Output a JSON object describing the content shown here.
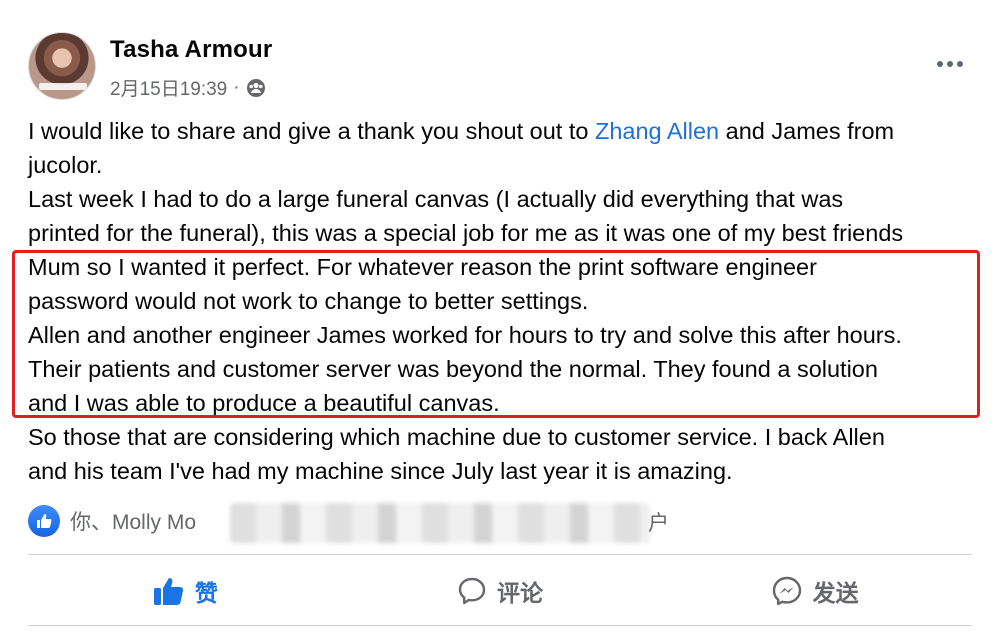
{
  "post": {
    "author": "Tasha Armour",
    "timestamp": "2月15日19:39",
    "separator": "·",
    "privacy_icon": "group-icon",
    "lines": [
      {
        "before": "I would like to share and give a thank you shout out to ",
        "mention": "Zhang Allen",
        "after": " and James from"
      },
      {
        "text": "jucolor."
      },
      {
        "text": "Last week I had to do a large funeral canvas (I actually did everything that was"
      },
      {
        "text": "printed for the funeral), this was a special job for me as it was one of my best friends"
      },
      {
        "text": "Mum so I wanted it perfect. For whatever reason the print software engineer"
      },
      {
        "text": "password would not work to change to better settings."
      },
      {
        "text": "Allen and another engineer James worked for hours to try and solve this after hours."
      },
      {
        "text": "Their patients and customer server was beyond the normal. They found a solution"
      },
      {
        "text": "and I was able to produce a beautiful canvas."
      },
      {
        "text": "So those that are considering which machine due to customer service. I back Allen"
      },
      {
        "text": "and his team I've had my machine since July last year it is amazing."
      }
    ],
    "highlight_color": "#e02020",
    "mention_color": "#216fdb"
  },
  "reactions": {
    "text": "你、Molly Mo",
    "tail": "户",
    "icon": "like-reaction-icon"
  },
  "actions": {
    "like": "赞",
    "comment": "评论",
    "send": "发送"
  }
}
